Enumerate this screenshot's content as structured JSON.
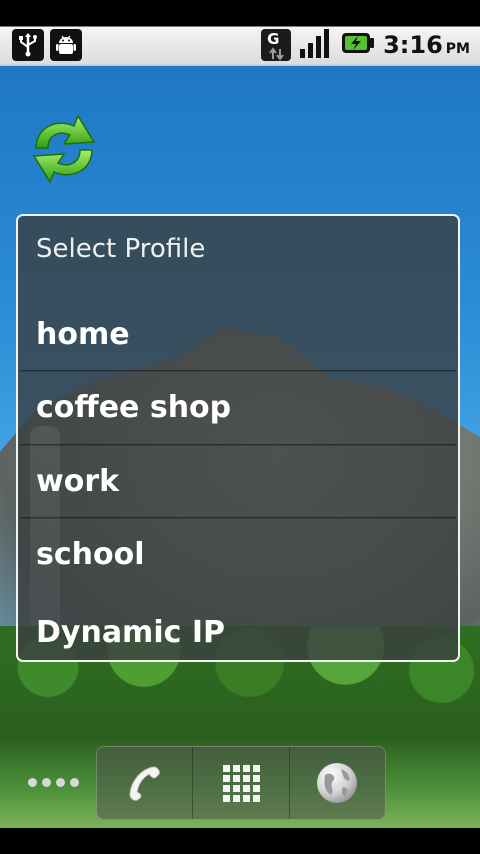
{
  "status_bar": {
    "icons_left": [
      "usb-icon",
      "android-debug-icon"
    ],
    "icons_right": [
      "gprs-data-icon",
      "signal-strength-icon",
      "battery-charging-icon"
    ],
    "clock": {
      "time": "3:16",
      "ampm": "PM"
    }
  },
  "home": {
    "shortcut_icon": "sync-arrows-icon"
  },
  "dialog": {
    "title": "Select Profile",
    "items": [
      {
        "label": "home"
      },
      {
        "label": "coffee shop"
      },
      {
        "label": "work"
      },
      {
        "label": "school"
      },
      {
        "label": "Dynamic IP"
      }
    ]
  },
  "dock": {
    "items": [
      "phone-icon",
      "app-drawer-icon",
      "browser-globe-icon"
    ]
  }
}
